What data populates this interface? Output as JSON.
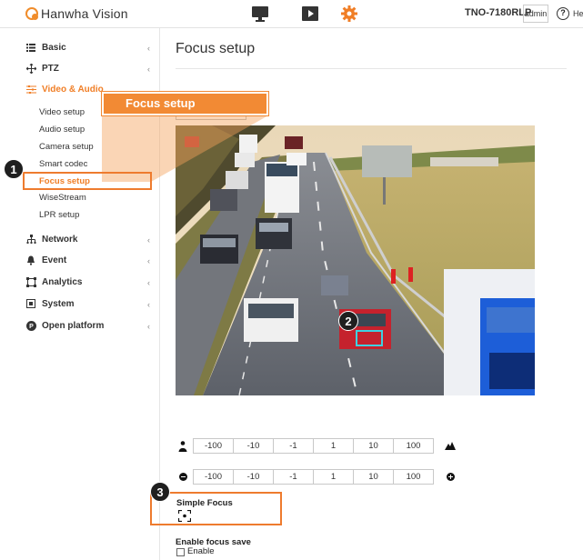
{
  "header": {
    "brand": "Hanwha Vision",
    "nav_icons": [
      "monitor-icon",
      "play-icon",
      "gear-icon"
    ],
    "model": "TNO-7180RLP",
    "user": "admin",
    "help_label": "He"
  },
  "sidebar": {
    "items": [
      {
        "label": "Basic",
        "icon": "list-icon"
      },
      {
        "label": "PTZ",
        "icon": "move-icon"
      },
      {
        "label": "Video & Audio",
        "icon": "sliders-icon",
        "active": true
      },
      {
        "label": "Network",
        "icon": "network-icon"
      },
      {
        "label": "Event",
        "icon": "bell-icon"
      },
      {
        "label": "Analytics",
        "icon": "analytics-icon"
      },
      {
        "label": "System",
        "icon": "system-icon"
      },
      {
        "label": "Open platform",
        "icon": "open-platform-icon"
      }
    ],
    "sub_items": [
      "Video setup",
      "Audio setup",
      "Camera setup",
      "Smart codec",
      "Focus setup",
      "WiseStream",
      "LPR setup"
    ],
    "active_sub": "Focus setup"
  },
  "main": {
    "title": "Focus setup",
    "callout_label": "Focus setup",
    "badges": [
      "1",
      "2",
      "3"
    ],
    "zoom_row": [
      "-100",
      "-10",
      "-1",
      "1",
      "10",
      "100"
    ],
    "focus_row": [
      "-100",
      "-10",
      "-1",
      "1",
      "10",
      "100"
    ],
    "simple_focus_label": "Simple Focus",
    "enable_focus_save_label": "Enable focus save",
    "enable_label": "Enable",
    "enable_checked": false
  },
  "colors": {
    "accent": "#f07e26",
    "callout": "#f28a34",
    "focus_box": "#3fd0e0"
  }
}
